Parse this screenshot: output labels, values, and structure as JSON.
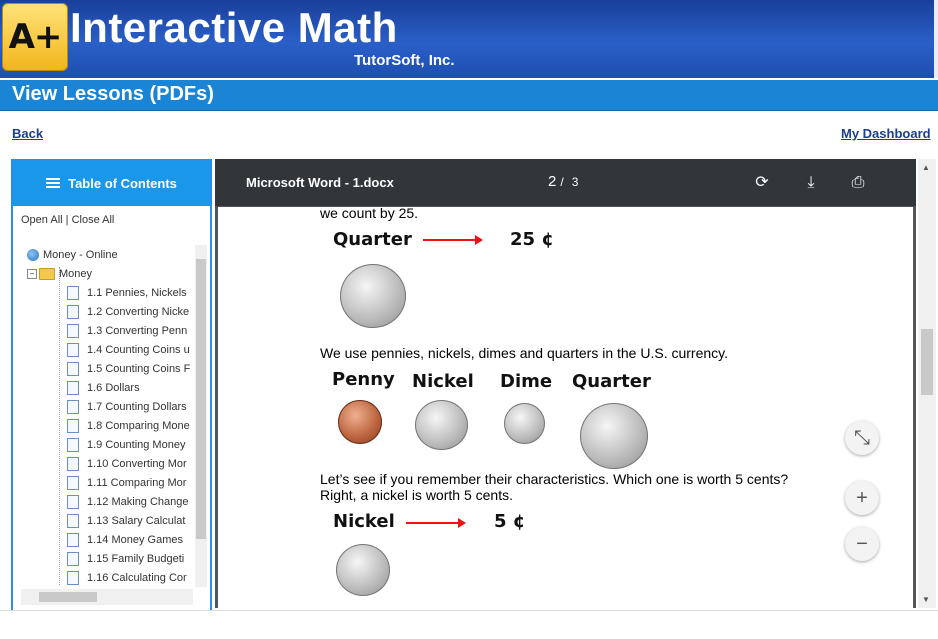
{
  "header": {
    "logo_text": "A+",
    "title": "Interactive Math",
    "subtitle": "TutorSoft, Inc."
  },
  "page": {
    "title": "View Lessons (PDFs)",
    "back_link": "Back",
    "dashboard_link": "My Dashboard"
  },
  "toc": {
    "heading": "Table of Contents",
    "open_all": "Open All",
    "separator": "|",
    "close_all": "Close All",
    "root": "Money - Online",
    "folder": "Money",
    "items": [
      "1.1 Pennies, Nickels",
      "1.2 Converting Nicke",
      "1.3 Converting Penn",
      "1.4 Counting Coins u",
      "1.5 Counting Coins F",
      "1.6 Dollars",
      "1.7 Counting Dollars",
      "1.8 Comparing Mone",
      "1.9 Counting Money",
      "1.10 Converting Mor",
      "1.11 Comparing Mor",
      "1.12 Making Change",
      "1.13 Salary Calculat",
      "1.14 Money Games",
      "1.15 Family Budgeti",
      "1.16 Calculating Cor"
    ]
  },
  "pdf_viewer": {
    "file_name": "Microsoft Word - 1.docx",
    "current_page": "2",
    "page_sep": "/",
    "total_pages": "3",
    "content": {
      "line_top": "we count by 25.",
      "quarter_label": "Quarter",
      "quarter_value": "25 ¢",
      "currency_text": "We use pennies, nickels, dimes and quarters in the U.S. currency.",
      "coin_names": [
        "Penny",
        "Nickel",
        "Dime",
        "Quarter"
      ],
      "question_line1": "Let’s see if you remember their characteristics.  Which one is worth 5 cents?",
      "question_line2": "Right, a nickel is worth 5 cents.",
      "nickel_label": "Nickel",
      "nickel_value": "5 ¢"
    },
    "zoom": {
      "fit": "⤡",
      "in": "+",
      "out": "−"
    }
  }
}
